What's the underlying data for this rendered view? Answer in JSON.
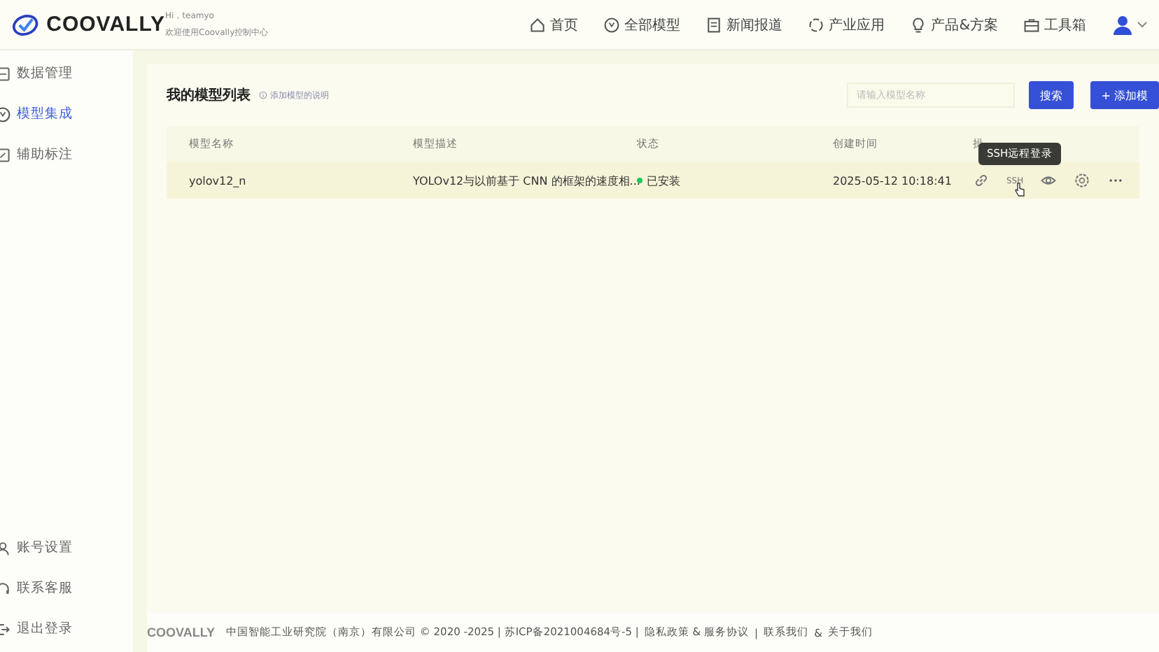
{
  "header": {
    "logo": "COOVALLY",
    "greeting": "Hi，teamyo",
    "welcome": "欢迎使用Coovally控制中心",
    "nav": [
      {
        "label": "首页",
        "selected": false
      },
      {
        "label": "全部模型",
        "selected": false
      },
      {
        "label": "新闻报道",
        "selected": false
      },
      {
        "label": "产业应用",
        "selected": false
      },
      {
        "label": "产品&方案",
        "selected": false
      },
      {
        "label": "工具箱",
        "selected": false
      }
    ]
  },
  "sidebar": {
    "items": [
      {
        "label": "数据管理",
        "selected": false
      },
      {
        "label": "模型集成",
        "selected": true
      },
      {
        "label": "辅助标注",
        "selected": false
      }
    ],
    "bottom_items": [
      {
        "label": "账号设置"
      },
      {
        "label": "联系客服"
      },
      {
        "label": "退出登录"
      }
    ]
  },
  "panel": {
    "title": "我的模型列表",
    "hint": "添加模型的说明",
    "search": {
      "placeholder": "请输入模型名称"
    },
    "search_button": "搜索",
    "add_button": "+ 添加模",
    "table": {
      "columns": [
        "模型名称",
        "模型描述",
        "状态",
        "创建时间",
        "操"
      ],
      "rows": [
        {
          "name": "yolov12_n",
          "description": "YOLOv12与以前基于 CNN 的框架的速度相...",
          "status": "已安装",
          "color": "#22c55e",
          "created": "2025-05-12 10:18:41",
          "hovered": true
        }
      ]
    },
    "ssh_label": "SSH",
    "tooltip": "SSH远程登录"
  },
  "footer": {
    "brand": "COOVALLY",
    "text": "中国智能工业研究院（南京）有限公司 © 2020 -2025 | 苏ICP备2021004684号-5 |",
    "links": [
      "隐私政策 & 服务协议",
      "联系我们",
      "关于我们"
    ],
    "separators": [
      "|",
      "&"
    ]
  }
}
